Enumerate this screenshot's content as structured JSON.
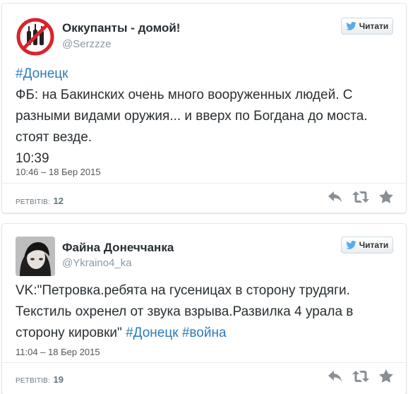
{
  "tweets": [
    {
      "user_name": "Оккупанты - домой!",
      "handle": "@Serzzze",
      "follow_label": "Читати",
      "text_hashtag": "#Донецк",
      "text_body": "ФБ: на Бакинских очень много вооруженных людей. С разными видами оружия... и вверх по Богдана до моста. стоят везде.",
      "text_time": "10:39",
      "timestamp": "10:46 – 18 Бер 2015",
      "retweets_label": "РЕТВІТІВ:",
      "retweets_count": "12"
    },
    {
      "user_name": "Файна Донеччанка",
      "handle": "@Ykraino4_ka",
      "follow_label": "Читати",
      "text_body": "VK:\"Петровка.ребята на гусеницах в сторону трудяги. Текстиль охренел от звука взрыва.Развилка 4 урала в сторону кировки\" ",
      "hashtag_1": "#Донецк",
      "hashtag_2": "#война",
      "timestamp": "11:04 – 18 Бер 2015",
      "retweets_label": "РЕТВІТІВ:",
      "retweets_count": "19"
    }
  ],
  "colors": {
    "link": "#2b7bb9",
    "twitter_blue": "#55acee",
    "icon_gray": "#888f95",
    "no_sign_red": "#d8242c"
  },
  "icons": {
    "reply": "reply-icon",
    "retweet": "retweet-icon",
    "favorite": "star-icon",
    "follow": "twitter-bird-icon"
  }
}
